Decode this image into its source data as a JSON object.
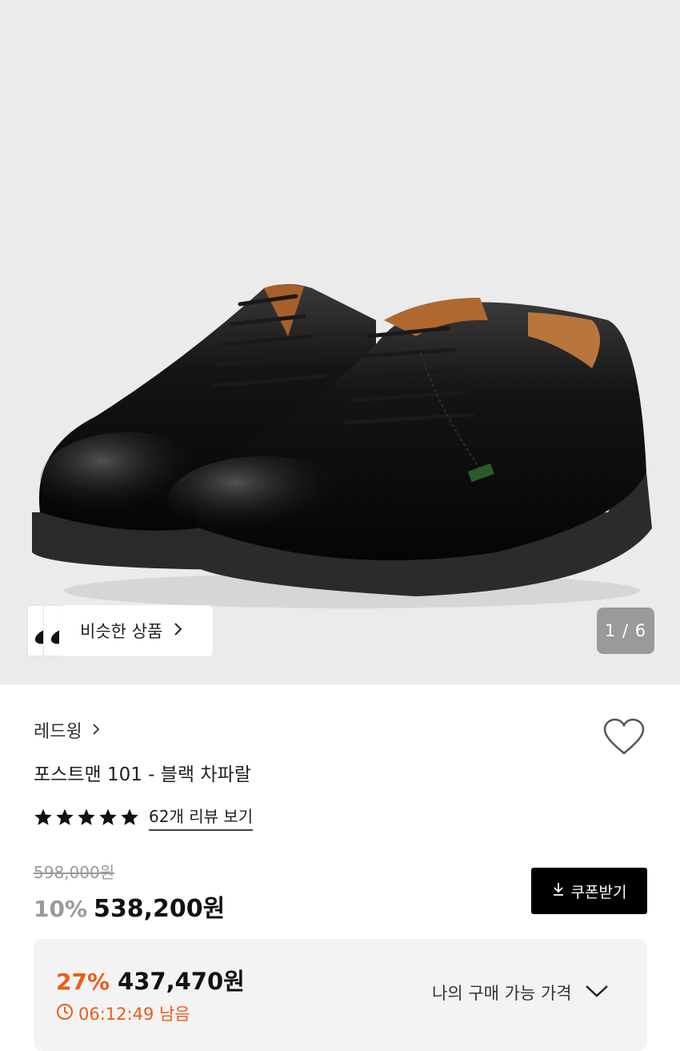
{
  "gallery": {
    "similar_label": "비슷한 상품",
    "counter": "1 / 6"
  },
  "product": {
    "brand": "레드윙",
    "title": "포스트맨 101 - 블랙 차파랄",
    "rating_stars": 5,
    "reviews_link": "62개 리뷰 보기",
    "original_price": "598,000원",
    "discount_pct": "10%",
    "sale_price": "538,200원",
    "coupon_label": "쿠폰받기"
  },
  "member_price": {
    "discount_pct": "27%",
    "price": "437,470원",
    "timer": "06:12:49 남음",
    "my_price_label": "나의 구매 가능 가격"
  },
  "colors": {
    "accent": "#ef5a1a",
    "hero_bg": "#ebebeb",
    "panel_bg": "#f3f3f3"
  }
}
